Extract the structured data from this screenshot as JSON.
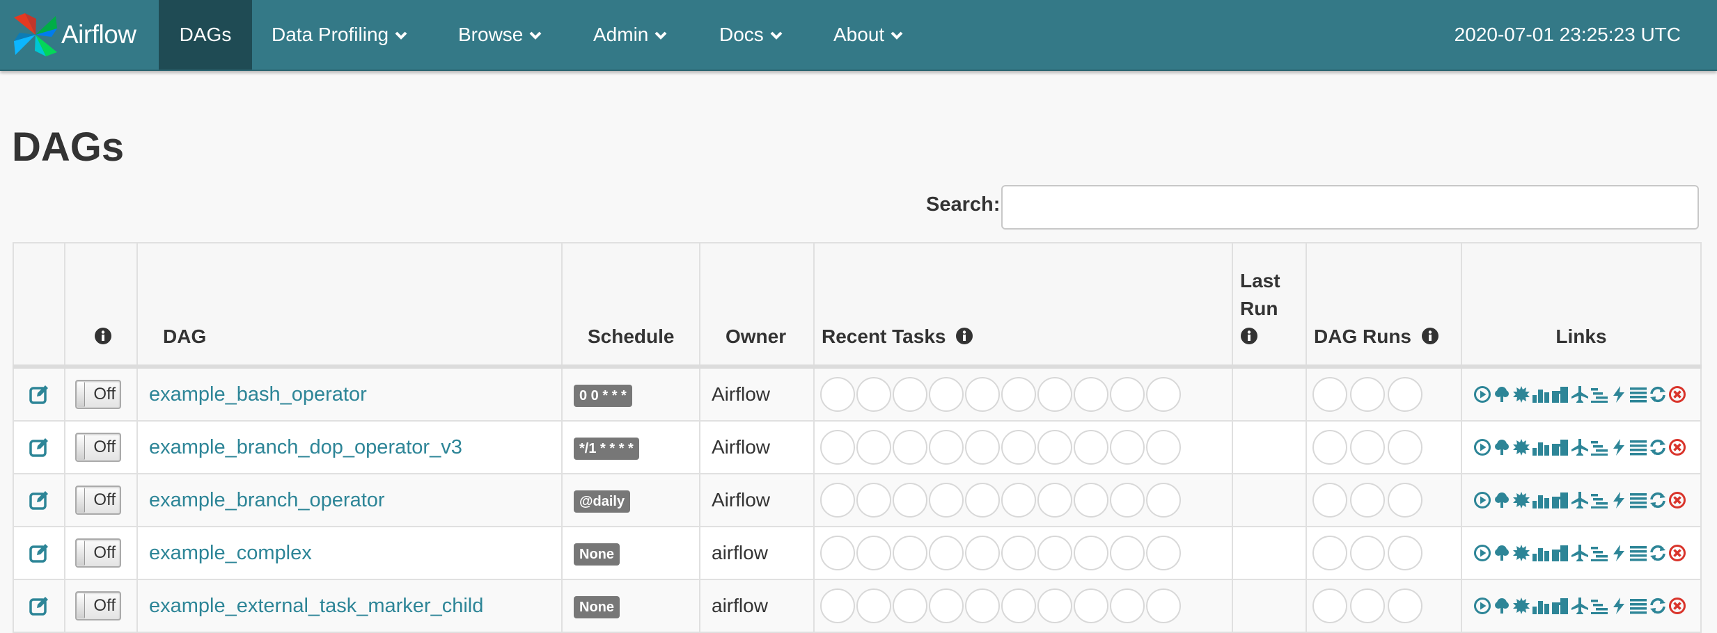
{
  "nav": {
    "brand": "Airflow",
    "items": [
      {
        "label": "DAGs",
        "dropdown": false,
        "active": true
      },
      {
        "label": "Data Profiling",
        "dropdown": true
      },
      {
        "label": "Browse",
        "dropdown": true
      },
      {
        "label": "Admin",
        "dropdown": true
      },
      {
        "label": "Docs",
        "dropdown": true
      },
      {
        "label": "About",
        "dropdown": true
      }
    ],
    "time": "2020-07-01 23:25:23 UTC"
  },
  "page": {
    "title": "DAGs",
    "search_label": "Search:",
    "search_value": ""
  },
  "table": {
    "headers": {
      "dag": "DAG",
      "schedule": "Schedule",
      "owner": "Owner",
      "recent_tasks": "Recent Tasks",
      "last_run": "Last Run",
      "dag_runs": "DAG Runs",
      "links": "Links"
    },
    "rows": [
      {
        "toggle": "Off",
        "dag": "example_bash_operator",
        "schedule": "0 0 * * *",
        "owner": "Airflow"
      },
      {
        "toggle": "Off",
        "dag": "example_branch_dop_operator_v3",
        "schedule": "*/1 * * * *",
        "owner": "Airflow"
      },
      {
        "toggle": "Off",
        "dag": "example_branch_operator",
        "schedule": "@daily",
        "owner": "Airflow"
      },
      {
        "toggle": "Off",
        "dag": "example_complex",
        "schedule": "None",
        "owner": "airflow"
      },
      {
        "toggle": "Off",
        "dag": "example_external_task_marker_child",
        "schedule": "None",
        "owner": "airflow"
      }
    ]
  },
  "icons": {
    "info": "info-circle-icon",
    "edit": "edit-icon",
    "links": [
      "trigger-dag-icon",
      "tree-view-icon",
      "graph-view-icon",
      "tasks-duration-icon",
      "task-tries-icon",
      "landing-times-icon",
      "gantt-icon",
      "code-view-icon",
      "logs-icon",
      "refresh-icon",
      "delete-icon"
    ]
  },
  "colors": {
    "navbar": "#347987",
    "nav_active": "#1f4b54",
    "link": "#2d8597",
    "badge": "#777777",
    "delete": "#d9342b"
  }
}
